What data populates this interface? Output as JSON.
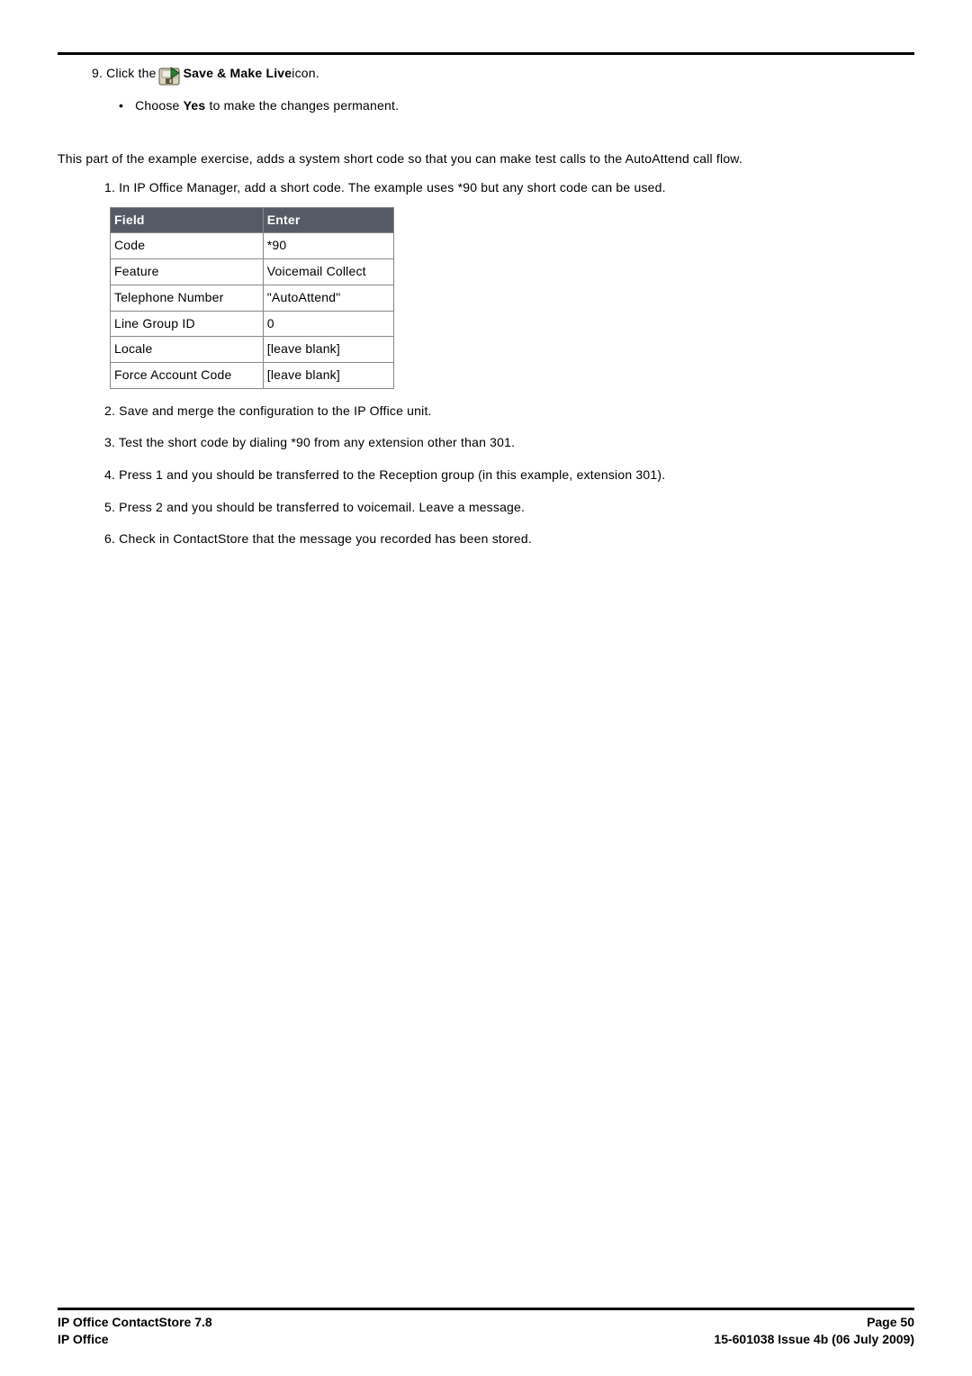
{
  "step9": {
    "num": "9.",
    "pre": "Click the ",
    "bold": "Save & Make Live",
    "post": " icon.",
    "bullet_pre": "Choose ",
    "bullet_bold": "Yes",
    "bullet_post": " to make the changes permanent."
  },
  "intro": "This part of the example exercise, adds a system short code so that you can make test calls to the AutoAttend call flow.",
  "steps": [
    "1. In IP Office Manager, add a short code. The example uses *90 but any short code can be used.",
    "2. Save and merge the configuration to the IP Office unit.",
    "3. Test the short code by dialing *90 from any extension other than 301.",
    "4. Press 1 and you should be transferred to the Reception group (in this example, extension 301).",
    "5. Press 2 and you should be transferred to voicemail. Leave a message.",
    "6. Check in ContactStore that the message you recorded has been stored."
  ],
  "table": {
    "head": {
      "c0": "Field",
      "c1": "Enter"
    },
    "rows": [
      {
        "c0": "Code",
        "c1": "*90"
      },
      {
        "c0": "Feature",
        "c1": "Voicemail Collect"
      },
      {
        "c0": "Telephone Number",
        "c1": "\"AutoAttend\""
      },
      {
        "c0": "Line Group ID",
        "c1": "0"
      },
      {
        "c0": "Locale",
        "c1": "[leave blank]"
      },
      {
        "c0": "Force Account Code",
        "c1": "[leave blank]"
      }
    ]
  },
  "footer": {
    "left1": "IP Office ContactStore 7.8",
    "left2": "IP Office",
    "right1": "Page 50",
    "right2": "15-601038 Issue 4b (06 July 2009)"
  }
}
